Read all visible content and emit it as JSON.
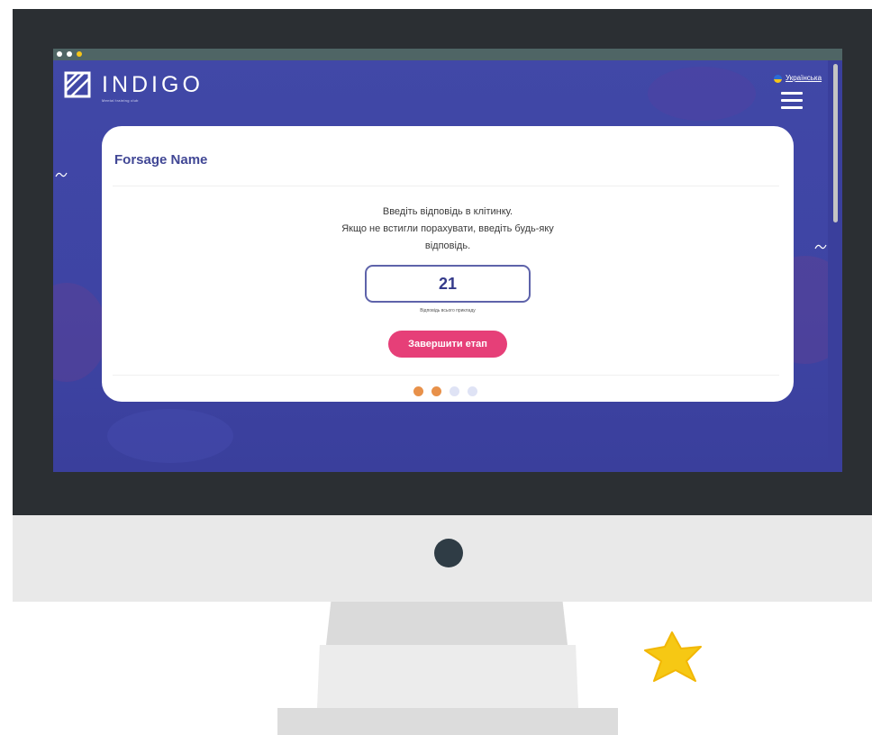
{
  "app": {
    "logo_text": "INDIGO",
    "tagline": "Mental training club",
    "language": "Українська"
  },
  "card": {
    "title": "Forsage Name",
    "instruction_line1": "Введіть відповідь в клітинку.",
    "instruction_line2": "Якщо не встигли порахувати, введіть будь-яку",
    "instruction_line3": "відповідь.",
    "answer_value": "21",
    "answer_hint": "Відповідь всього прикладу",
    "finish_button": "Завершити етап"
  },
  "progress": {
    "steps_total": 4,
    "steps_completed": 2,
    "active_color": "#e8914a",
    "inactive_color": "#dfe3f5"
  },
  "colors": {
    "background": "#4148a7",
    "accent": "#e63f78",
    "title": "#414795"
  },
  "icons": [
    "logo-mark-icon",
    "ukraine-flag-icon",
    "hamburger-menu-icon",
    "star-icon"
  ]
}
